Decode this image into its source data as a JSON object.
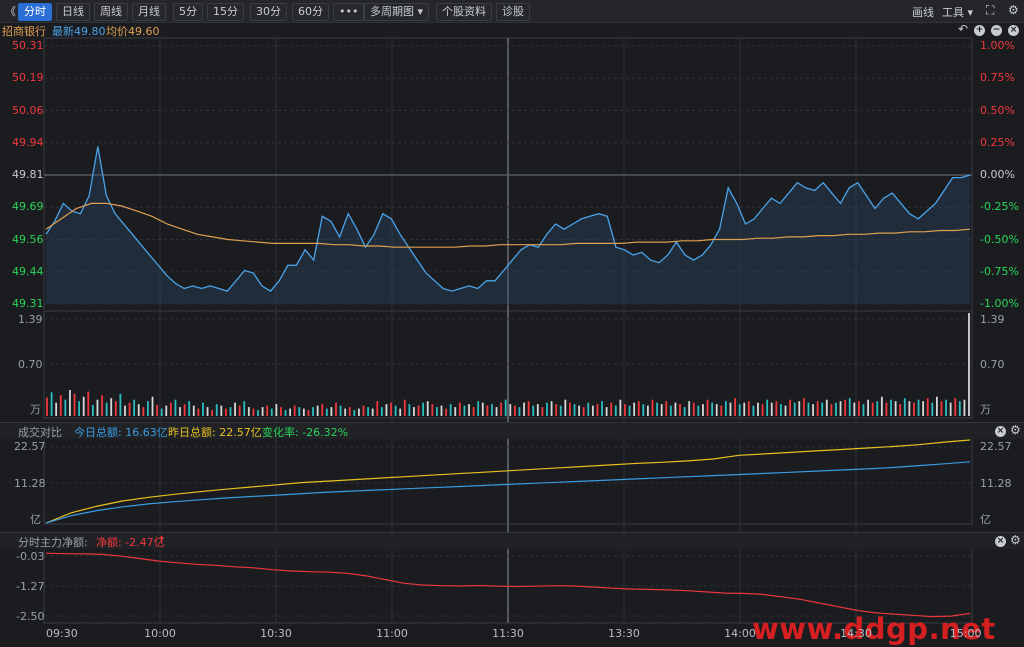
{
  "toolbar": {
    "back": "《",
    "tabs": [
      {
        "label": "分时",
        "active": true
      },
      {
        "label": "日线"
      },
      {
        "label": "周线"
      },
      {
        "label": "月线"
      },
      {
        "label": "5分"
      },
      {
        "label": "15分"
      },
      {
        "label": "30分"
      },
      {
        "label": "60分"
      },
      {
        "label": "•••"
      },
      {
        "label": "多周期图 ▾"
      },
      {
        "label": "个股资料"
      },
      {
        "label": "诊股"
      }
    ],
    "draw_label": "画线",
    "tools_label": "工具 ▾",
    "fullscreen_icon": "fullscreen-icon"
  },
  "info": {
    "stock_name": "招商银行",
    "latest": "最新49.80",
    "avg": "均价49.60"
  },
  "price_axis": {
    "left": [
      "50.31",
      "50.19",
      "50.06",
      "49.94",
      "49.81",
      "49.69",
      "49.56",
      "49.44",
      "49.31"
    ],
    "right": [
      "1.00%",
      "0.75%",
      "0.50%",
      "0.25%",
      "0.00%",
      "-0.25%",
      "-0.50%",
      "-0.75%",
      "-1.00%"
    ]
  },
  "volume_axis": {
    "top": "1.39",
    "mid": "0.70",
    "unit": "万"
  },
  "compare": {
    "title": "成交对比",
    "today": "今日总额: 16.63亿",
    "yesterday": "昨日总额: 22.57亿",
    "change": "变化率: -26.32%",
    "axis_top": "22.57",
    "axis_mid": "11.28",
    "unit": "亿"
  },
  "mainforce": {
    "title": "分时主力净额:",
    "net": "净额: -2.47亿",
    "arrow": "↑",
    "axis": [
      "-0.03",
      "-1.27",
      "-2.50"
    ]
  },
  "time_axis": [
    "09:30",
    "10:00",
    "10:30",
    "11:00",
    "11:30",
    "13:30",
    "14:00",
    "14:30",
    "15:00"
  ],
  "watermark": "www.ddgp.net",
  "colors": {
    "price": "#4aa3e8",
    "avg": "#e0a050",
    "yesterday": "#e8c020",
    "today": "#3a9be0",
    "net": "#e8383c",
    "up": "#f0383d",
    "down": "#2bd45a"
  },
  "chart_data": [
    {
      "type": "line",
      "title": "分时",
      "ylim": [
        49.31,
        50.31
      ],
      "series": [
        {
          "name": "最新",
          "values": [
            49.58,
            49.63,
            49.7,
            49.67,
            49.66,
            49.73,
            49.92,
            49.73,
            49.66,
            49.62,
            49.58,
            49.54,
            49.5,
            49.46,
            49.42,
            49.39,
            49.37,
            49.38,
            49.37,
            49.38,
            49.37,
            49.36,
            49.4,
            49.44,
            49.43,
            49.38,
            49.36,
            49.4,
            49.46,
            49.46,
            49.52,
            49.48,
            49.65,
            49.63,
            49.57,
            49.66,
            49.6,
            49.53,
            49.58,
            49.66,
            49.64,
            49.58,
            49.53,
            49.48,
            49.43,
            49.4,
            49.37,
            49.36,
            49.37,
            49.38,
            49.37,
            49.4,
            49.4,
            49.44,
            49.48,
            49.52,
            49.54,
            49.53,
            49.58,
            49.62,
            49.6,
            49.62,
            49.64,
            49.65,
            49.66,
            49.65,
            49.53,
            49.52,
            49.5,
            49.51,
            49.48,
            49.47,
            49.5,
            49.55,
            49.5,
            49.48,
            49.5,
            49.54,
            49.6,
            49.76,
            49.7,
            49.62,
            49.64,
            49.68,
            49.72,
            49.7,
            49.74,
            49.78,
            49.76,
            49.75,
            49.78,
            49.74,
            49.7,
            49.76,
            49.78,
            49.73,
            49.68,
            49.72,
            49.74,
            49.7,
            49.66,
            49.64,
            49.67,
            49.7,
            49.75,
            49.8,
            49.8,
            49.81
          ]
        },
        {
          "name": "均价",
          "values": [
            49.6,
            49.64,
            49.68,
            49.7,
            49.7,
            49.69,
            49.67,
            49.65,
            49.62,
            49.6,
            49.58,
            49.57,
            49.56,
            49.555,
            49.55,
            49.545,
            49.545,
            49.545,
            49.545,
            49.54,
            49.54,
            49.535,
            49.535,
            49.53,
            49.53,
            49.53,
            49.53,
            49.53,
            49.535,
            49.535,
            49.54,
            49.54,
            49.54,
            49.54,
            49.54,
            49.545,
            49.545,
            49.545,
            49.545,
            49.55,
            49.55,
            49.55,
            49.555,
            49.555,
            49.56,
            49.56,
            49.56,
            49.565,
            49.565,
            49.57,
            49.57,
            49.575,
            49.575,
            49.58,
            49.58,
            49.585,
            49.585,
            49.59,
            49.59,
            49.595,
            49.595,
            49.6
          ]
        }
      ]
    },
    {
      "type": "bar",
      "title": "成交量",
      "ylim": [
        0,
        1.39
      ],
      "values": [
        0.25,
        0.32,
        0.18,
        0.28,
        0.22,
        0.35,
        0.3,
        0.2,
        0.26,
        0.33,
        0.15,
        0.22,
        0.28,
        0.18,
        0.24,
        0.2,
        0.3,
        0.14,
        0.18,
        0.22,
        0.16,
        0.12,
        0.2,
        0.26,
        0.15,
        0.1,
        0.14,
        0.18,
        0.22,
        0.12,
        0.16,
        0.2,
        0.14,
        0.1,
        0.18,
        0.12,
        0.08,
        0.16,
        0.14,
        0.1,
        0.12,
        0.18,
        0.14,
        0.2,
        0.12,
        0.1,
        0.08,
        0.12,
        0.14,
        0.1,
        0.16,
        0.12,
        0.08,
        0.1,
        0.14,
        0.12,
        0.1,
        0.08,
        0.12,
        0.14,
        0.16,
        0.1,
        0.12,
        0.18,
        0.14,
        0.1,
        0.12,
        0.08,
        0.1,
        0.14,
        0.12,
        0.1,
        0.2,
        0.12,
        0.16,
        0.18,
        0.14,
        0.1,
        0.22,
        0.16,
        0.12,
        0.14,
        0.18,
        0.2,
        0.16,
        0.12,
        0.14,
        0.1,
        0.16,
        0.12,
        0.18,
        0.14,
        0.16,
        0.12,
        0.2,
        0.18,
        0.14,
        0.16,
        0.12,
        0.18,
        0.22,
        0.16,
        0.14,
        0.12,
        0.18,
        0.2,
        0.14,
        0.16,
        0.12,
        0.18,
        0.2,
        0.16,
        0.14,
        0.22,
        0.18,
        0.16,
        0.14,
        0.12,
        0.18,
        0.14,
        0.16,
        0.2,
        0.12,
        0.18,
        0.14,
        0.22,
        0.16,
        0.14,
        0.18,
        0.2,
        0.16,
        0.14,
        0.22,
        0.18,
        0.16,
        0.2,
        0.14,
        0.18,
        0.16,
        0.12,
        0.2,
        0.18,
        0.14,
        0.16,
        0.22,
        0.18,
        0.16,
        0.14,
        0.2,
        0.18,
        0.24,
        0.16,
        0.18,
        0.2,
        0.14,
        0.18,
        0.16,
        0.22,
        0.18,
        0.2,
        0.16,
        0.14,
        0.22,
        0.18,
        0.2,
        0.24,
        0.18,
        0.16,
        0.2,
        0.18,
        0.22,
        0.16,
        0.18,
        0.2,
        0.22,
        0.24,
        0.18,
        0.2,
        0.16,
        0.22,
        0.18,
        0.2,
        0.26,
        0.18,
        0.22,
        0.2,
        0.16,
        0.24,
        0.2,
        0.18,
        0.22,
        0.2,
        0.24,
        0.18,
        0.26,
        0.2,
        0.22,
        0.18,
        0.24,
        0.2,
        0.22,
        1.39
      ]
    },
    {
      "type": "line",
      "title": "成交对比",
      "ylim": [
        0,
        22.57
      ],
      "series": [
        {
          "name": "昨日总额",
          "values": [
            0,
            2.8,
            4.6,
            6.0,
            7.0,
            7.8,
            8.5,
            9.2,
            9.8,
            10.4,
            11.0,
            11.4,
            11.8,
            12.2,
            12.6,
            13.0,
            13.4,
            13.8,
            14.2,
            14.6,
            15.0,
            15.4,
            15.8,
            16.2,
            16.5,
            16.9,
            17.4,
            18.4,
            18.8,
            19.2,
            19.6,
            20.0,
            20.4,
            20.8,
            21.3,
            22.0,
            22.57
          ]
        },
        {
          "name": "今日总额",
          "values": [
            0,
            2.0,
            3.4,
            4.4,
            5.2,
            5.8,
            6.3,
            6.8,
            7.2,
            7.6,
            8.0,
            8.4,
            8.7,
            9.0,
            9.3,
            9.6,
            9.9,
            10.2,
            10.5,
            10.8,
            11.1,
            11.4,
            11.7,
            12.0,
            12.3,
            12.6,
            12.9,
            13.2,
            13.5,
            13.8,
            14.1,
            14.4,
            14.7,
            15.1,
            15.6,
            16.1,
            16.63
          ]
        }
      ]
    },
    {
      "type": "line",
      "title": "分时主力净额",
      "ylim": [
        -2.78,
        0.1
      ],
      "series": [
        {
          "name": "净额",
          "values": [
            -0.03,
            -0.05,
            -0.06,
            -0.08,
            -0.15,
            -0.25,
            -0.35,
            -0.42,
            -0.48,
            -0.52,
            -0.58,
            -0.62,
            -0.7,
            -0.75,
            -0.78,
            -0.8,
            -0.85,
            -0.95,
            -1.1,
            -1.25,
            -1.32,
            -1.35,
            -1.36,
            -1.34,
            -1.37,
            -1.38,
            -1.37,
            -1.35,
            -1.36,
            -1.4,
            -1.45,
            -1.48,
            -1.5,
            -1.52,
            -1.55,
            -1.6,
            -1.65,
            -1.66,
            -1.7,
            -1.8,
            -1.9,
            -2.05,
            -2.2,
            -2.35,
            -2.45,
            -2.5,
            -2.55,
            -2.6,
            -2.58,
            -2.47
          ]
        }
      ]
    }
  ]
}
